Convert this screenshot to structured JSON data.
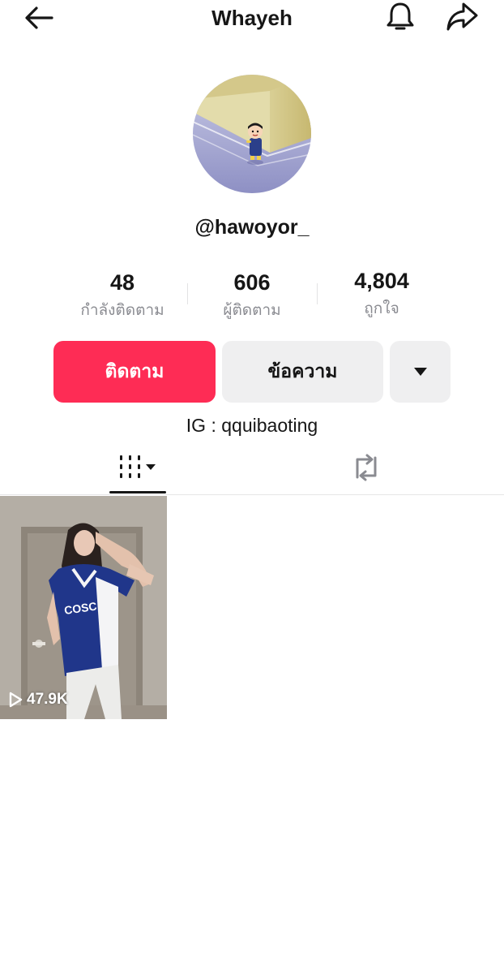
{
  "header": {
    "title": "Whayeh",
    "back_icon": "arrow-left-icon",
    "bell_icon": "bell-icon",
    "share_icon": "share-icon"
  },
  "profile": {
    "username": "@hawoyor_",
    "avatar_icon": "cartoon-avatar"
  },
  "stats": [
    {
      "value": "48",
      "label": "กำลังติดตาม"
    },
    {
      "value": "606",
      "label": "ผู้ติดตาม"
    },
    {
      "value": "4,804",
      "label": "ถูกใจ"
    }
  ],
  "actions": {
    "follow_label": "ติดตาม",
    "message_label": "ข้อความ",
    "more_icon": "caret-down-icon"
  },
  "bio": "IG : qquibaoting",
  "tabs": {
    "videos_icon": "grid-columns-icon",
    "reposts_icon": "repost-icon"
  },
  "videos": [
    {
      "views": "47.9K",
      "play_icon": "play-outline-icon"
    }
  ],
  "colors": {
    "accent": "#fe2c55",
    "secondary_button": "#efeff0",
    "muted_text": "#8a8b91"
  }
}
